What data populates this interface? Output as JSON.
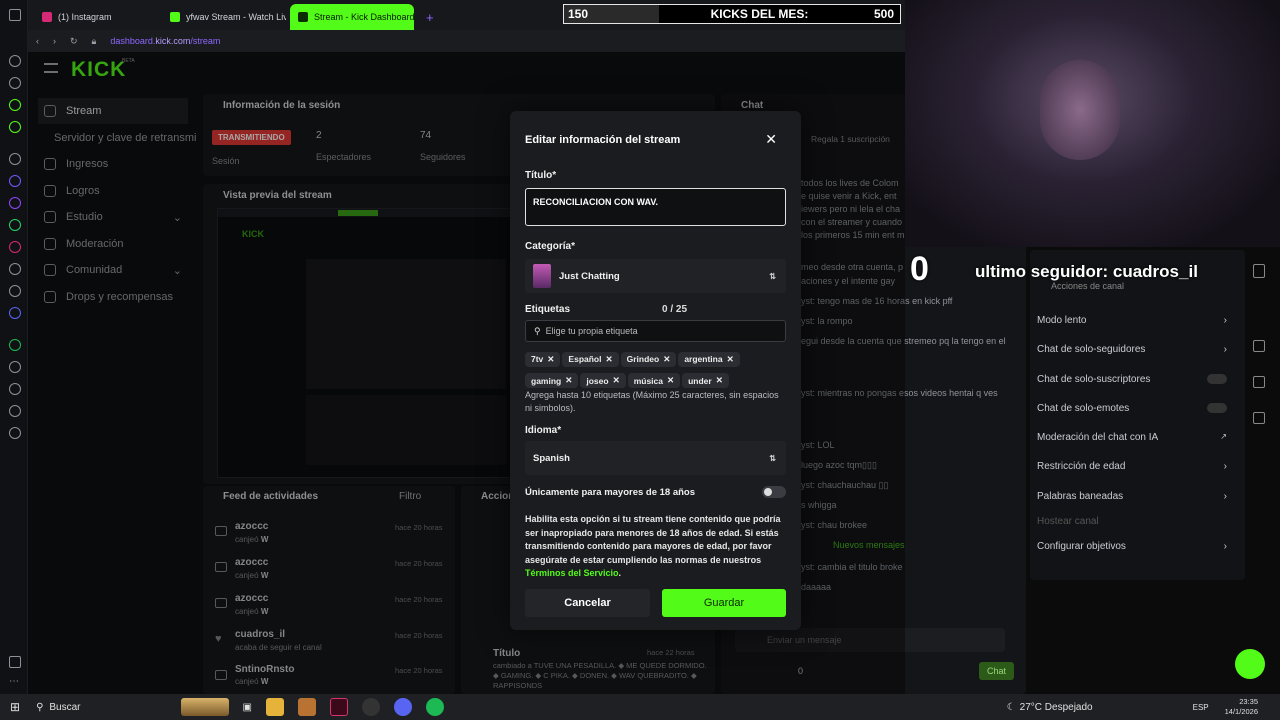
{
  "browser": {
    "tabs": [
      {
        "label": "(1) Instagram",
        "color": "#d62976"
      },
      {
        "label": "yfwav Stream - Watch Liv",
        "color": "#53fc18"
      },
      {
        "label": "Stream - Kick Dashboard",
        "color": "#0b2a00"
      }
    ],
    "new_tab": "+",
    "url_prefix": "dashboard.",
    "url_domain": "kick.com",
    "url_path": "/stream"
  },
  "kicks_bar": {
    "current": "150",
    "label": "KICKS DEL MES:",
    "goal": "500"
  },
  "dashboard": {
    "logo": "KICK",
    "logo_badge": "BETA",
    "nav": [
      {
        "label": "Stream",
        "icon": "broadcast-icon"
      },
      {
        "label": "Servidor y clave de retransmi",
        "icon": ""
      },
      {
        "label": "Ingresos",
        "icon": "chart-icon"
      },
      {
        "label": "Logros",
        "icon": "trophy-icon"
      },
      {
        "label": "Estudio",
        "icon": "studio-icon"
      },
      {
        "label": "Moderación",
        "icon": "shield-icon"
      },
      {
        "label": "Comunidad",
        "icon": "people-icon"
      },
      {
        "label": "Drops y recompensas",
        "icon": "gift-icon"
      }
    ],
    "session": {
      "title": "Información de la sesión",
      "status_badge": "TRANSMITIENDO",
      "status_sub": "Sesión",
      "viewers_value": "2",
      "viewers_label": "Espectadores",
      "followers_value": "74",
      "followers_label": "Seguidores"
    },
    "preview_title": "Vista previa del stream",
    "chat": {
      "title": "Chat",
      "sub_info": "Regala 1 suscripción",
      "new_messages": "Nuevos mensajes",
      "input_placeholder": "Enviar un mensaje",
      "send_label": "Chat",
      "count": "0",
      "lines": [
        "todos los lives de Colom",
        "e quise venir a Kick, ent",
        "iewers pero ni lela el cha",
        "con el streamer y cuando",
        "los primeros 15 min ent m",
        "meo desde otra cuenta, p",
        "aciones y el intente gay",
        "yst: tengo mas de 16 horas en kick pff",
        "yst: la rompo",
        "egui desde la cuenta que stremeo pq la tengo en el",
        "yst: mientras no pongas esos videos hentai q ves",
        "yst: LOL",
        "luego azoc tqm▯▯▯",
        "yst: chauchauchau ▯▯",
        "s whigga",
        "yst: chau brokee",
        "yst: cambia el titulo broke",
        "daaaaa"
      ]
    },
    "channel_actions": {
      "title": "Acciones de canal",
      "items": [
        {
          "label": "Modo lento",
          "control": "chevron"
        },
        {
          "label": "Chat de solo-seguidores",
          "control": "chevron"
        },
        {
          "label": "Chat de solo-suscriptores",
          "control": "toggle"
        },
        {
          "label": "Chat de solo-emotes",
          "control": "toggle"
        },
        {
          "label": "Moderación del chat con IA",
          "control": "external"
        },
        {
          "label": "Restricción de edad",
          "control": "chevron"
        },
        {
          "label": "Palabras baneadas",
          "control": "chevron"
        },
        {
          "label": "Hostear canal",
          "control": "none"
        },
        {
          "label": "Configurar objetivos",
          "control": "chevron"
        }
      ]
    },
    "feed": {
      "title": "Feed de actividades",
      "filter": "Filtro",
      "items": [
        {
          "user": "azoccc",
          "action": "canjeó",
          "reward": "W",
          "time": "hace 20 horas"
        },
        {
          "user": "azoccc",
          "action": "canjeó",
          "reward": "W",
          "time": "hace 20 horas"
        },
        {
          "user": "azoccc",
          "action": "canjeó",
          "reward": "W",
          "time": "hace 20 horas"
        },
        {
          "user": "cuadros_il",
          "action": "acaba de seguir el canal",
          "reward": "",
          "time": "hace 20 horas"
        },
        {
          "user": "SntinoRnsto",
          "action": "canjeó",
          "reward": "W",
          "time": "hace 20 horas"
        }
      ]
    },
    "actions_panel": {
      "title": "Acciones",
      "item_title": "Título",
      "item_time": "hace 22 horas",
      "item_text": "cambiado a TUVE UNA PESADILLA. ◆ ME QUEDE DORMIDO. ◆ GAMING. ◆ C PIKA. ◆ DONEN. ◆ WAV QUEBRADITO. ◆ RAPPISONDS"
    }
  },
  "modal": {
    "title": "Editar información del stream",
    "title_label": "Título*",
    "title_value": "RECONCILIACION CON WAV.",
    "category_label": "Categoría*",
    "category_value": "Just Chatting",
    "tags_label": "Etiquetas",
    "tags_count": "0 / 25",
    "tags_placeholder": "Elige tu propia etiqueta",
    "tags": [
      "7tv",
      "Español",
      "Grindeo",
      "argentina",
      "gaming",
      "joseo",
      "música",
      "under"
    ],
    "tags_hint": "Agrega hasta 10 etiquetas (Máximo 25 caracteres, sin espacios ni simbolos).",
    "language_label": "Idioma*",
    "language_value": "Spanish",
    "adult_label": "Únicamente para mayores de 18 años",
    "adult_enabled": false,
    "adult_desc": "Habilita esta opción si tu stream tiene contenido que podría ser inapropiado para menores de 18 años de edad. Si estás transmitiendo contenido para mayores de edad, por favor asegúrate de estar cumpliendo las normas de nuestros ",
    "terms_link": "Términos del Servicio",
    "terms_end": ".",
    "cancel_label": "Cancelar",
    "save_label": "Guardar",
    "accent": "#53fc18"
  },
  "overlay": {
    "follower_count": "0",
    "last_follower": "ultimo seguidor: cuadros_il"
  },
  "taskbar": {
    "search_label": "Buscar",
    "weather": "27°C  Despejado",
    "lang": "ESP",
    "time": "23:35",
    "date": "14/1/2026"
  }
}
